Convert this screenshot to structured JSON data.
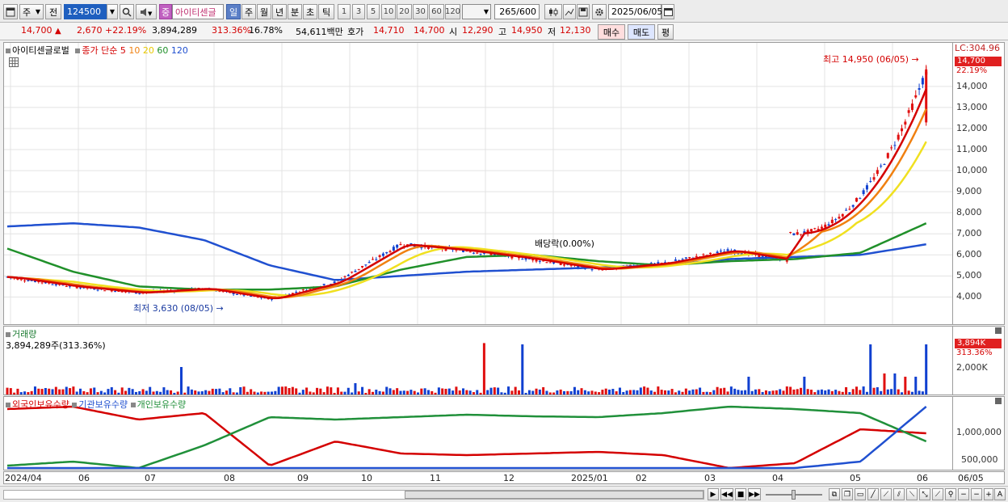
{
  "toolbar": {
    "sel1": "주",
    "sel2": "전",
    "code": "124500",
    "badge": "중",
    "stock_name": "아이티센글",
    "periods": [
      "일",
      "주",
      "월",
      "년",
      "분",
      "초",
      "틱"
    ],
    "active_period": "일",
    "counts": [
      "1",
      "3",
      "5",
      "10",
      "20",
      "30",
      "60",
      "120"
    ],
    "view_count": "265",
    "view_total": "/600",
    "date": "2025/06/05"
  },
  "infobar": {
    "price": "14,700",
    "up_mark": "▲",
    "change": "2,670",
    "pct": "+22.19%",
    "volume": "3,894,289",
    "vol_ratio": "313.36%",
    "turnover": "16.78%",
    "amount": "54,611백만",
    "ask_label": "호가",
    "ask": "14,710",
    "bid": "14,700",
    "open_label": "시",
    "open": "12,290",
    "high_label": "고",
    "high": "14,950",
    "low_label": "저",
    "low": "12,130",
    "buy": "매수",
    "sell": "매도",
    "eval": "평"
  },
  "price_panel": {
    "name": "아이티센글로벌",
    "ma_label": "종가 단순",
    "ma_periods": [
      "5",
      "10",
      "20",
      "60",
      "120"
    ],
    "ma_colors": [
      "#d40000",
      "#f08010",
      "#f0e020",
      "#20902a",
      "#2050d0"
    ],
    "lc_label": "LC:304.96",
    "current_tag": "14,700",
    "current_pct": "22.19%",
    "high_note": "최고 14,950 (06/05)",
    "low_note": "최저 3,630 (08/05)",
    "dividend_note": "배당락(0.00%)",
    "y_ticks": [
      "14,000",
      "13,000",
      "12,000",
      "11,000",
      "10,000",
      "9,000",
      "8,000",
      "7,000",
      "6,000",
      "5,000",
      "4,000"
    ]
  },
  "volume_panel": {
    "title": "거래량",
    "value": "3,894,289주(313.36%)",
    "tag": "3,894K",
    "tag_pct": "313.36%",
    "y_ticks": [
      "2,000K"
    ]
  },
  "holding_panel": {
    "legends": [
      "외국인보유수량",
      "기관보유수량",
      "개인보유수량"
    ],
    "legend_colors": [
      "#d40000",
      "#2050d0",
      "#20903a"
    ],
    "y_ticks": [
      "1,000,000",
      "500,000"
    ]
  },
  "x_axis": {
    "labels": [
      "2024/04",
      "06",
      "07",
      "08",
      "09",
      "10",
      "11",
      "12",
      "2025/01",
      "02",
      "03",
      "04",
      "05",
      "06"
    ],
    "last": "06/05"
  },
  "chart_data": {
    "type": "candlestick",
    "ylim": [
      3400,
      15300
    ],
    "x": [
      "2024/04",
      "2024/05",
      "2024/06",
      "2024/07",
      "2024/08",
      "2024/09",
      "2024/10",
      "2024/11",
      "2024/12",
      "2025/01",
      "2025/02",
      "2025/03",
      "2025/04",
      "2025/05",
      "2025/06"
    ],
    "close_approx": [
      4950,
      4500,
      4200,
      4400,
      3900,
      4700,
      6500,
      6200,
      5800,
      5300,
      5600,
      6200,
      5700,
      7000,
      14700
    ],
    "ma120_approx": [
      7350,
      7500,
      7300,
      6700,
      5500,
      4800,
      5000,
      5200,
      5300,
      5400,
      5500,
      5800,
      5900,
      6000,
      6500
    ],
    "ma60_approx": [
      6300,
      5200,
      4500,
      4350,
      4350,
      4500,
      5300,
      5900,
      6000,
      5700,
      5500,
      5700,
      5800,
      6100,
      7500
    ],
    "volume_spikes": [
      {
        "date": "2024/10",
        "value": "large"
      },
      {
        "date": "2025/05",
        "value": "large"
      },
      {
        "date": "2025/06/05",
        "value": 3894289
      }
    ],
    "annotations": [
      "최고 14,950 (06/05)",
      "최저 3,630 (08/05)",
      "배당락(0.00%)"
    ]
  }
}
